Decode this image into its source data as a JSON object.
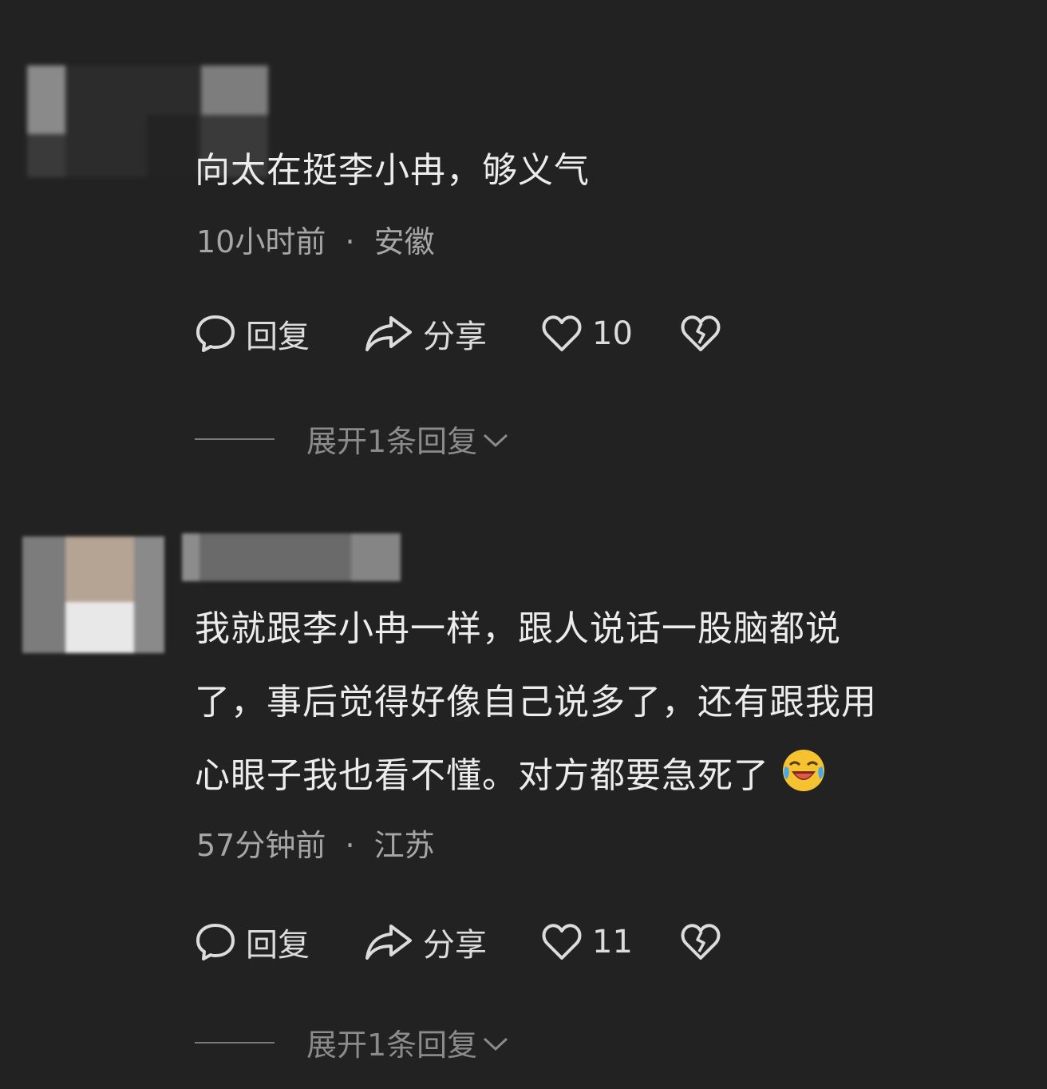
{
  "comments": [
    {
      "text": "向太在挺李小冉，够义气",
      "time": "10小时前",
      "location": "安徽",
      "separator": "·",
      "reply_label": "回复",
      "share_label": "分享",
      "likes": "10",
      "expand_label": "展开1条回复"
    },
    {
      "text_lines": [
        "我就跟李小冉一样，跟人说话一股脑都说",
        "了，事后觉得好像自己说多了，还有跟我用",
        "心眼子我也看不懂。对方都要急死了"
      ],
      "emoji": "laughing-crying-emoji",
      "time": "57分钟前",
      "location": "江苏",
      "separator": "·",
      "reply_label": "回复",
      "share_label": "分享",
      "likes": "11",
      "expand_label": "展开1条回复"
    }
  ],
  "icons": {
    "reply": "comment-bubble-icon",
    "share": "share-arrow-icon",
    "like": "heart-icon",
    "dislike": "broken-heart-icon",
    "expand": "chevron-down-icon"
  },
  "colors": {
    "background": "#232222",
    "text": "#ececec",
    "meta": "#a6a6a6",
    "muted": "#8b8b8b"
  }
}
